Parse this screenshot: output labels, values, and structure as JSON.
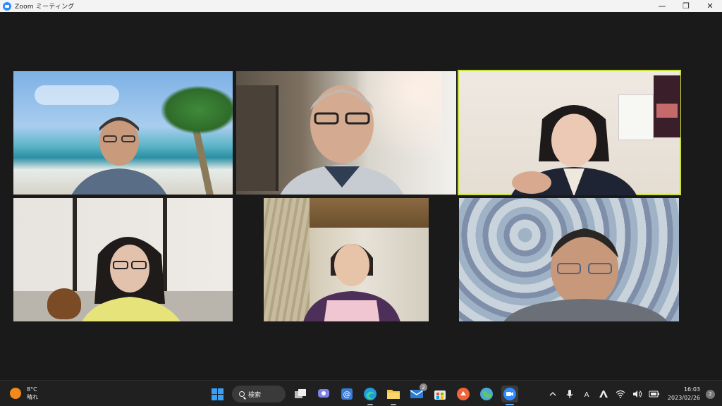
{
  "window": {
    "title": "Zoom ミーティング",
    "controls": {
      "minimize": "—",
      "maximize": "❐",
      "close": "✕"
    }
  },
  "meeting": {
    "active_speaker_color": "#c8e03c",
    "participants": [
      {
        "tile": "beach-background"
      },
      {
        "tile": "room-with-window"
      },
      {
        "tile": "room-with-calendar",
        "active_speaker": true
      },
      {
        "tile": "living-room"
      },
      {
        "tile": "tatami-room"
      },
      {
        "tile": "floral-fabric"
      }
    ]
  },
  "taskbar": {
    "weather": {
      "temp": "8°C",
      "condition": "晴れ"
    },
    "search_label": "検索",
    "badges": {
      "mail": "2"
    },
    "tray": {
      "time": "16:03",
      "date": "2023/02/26",
      "notifications": "2"
    }
  }
}
